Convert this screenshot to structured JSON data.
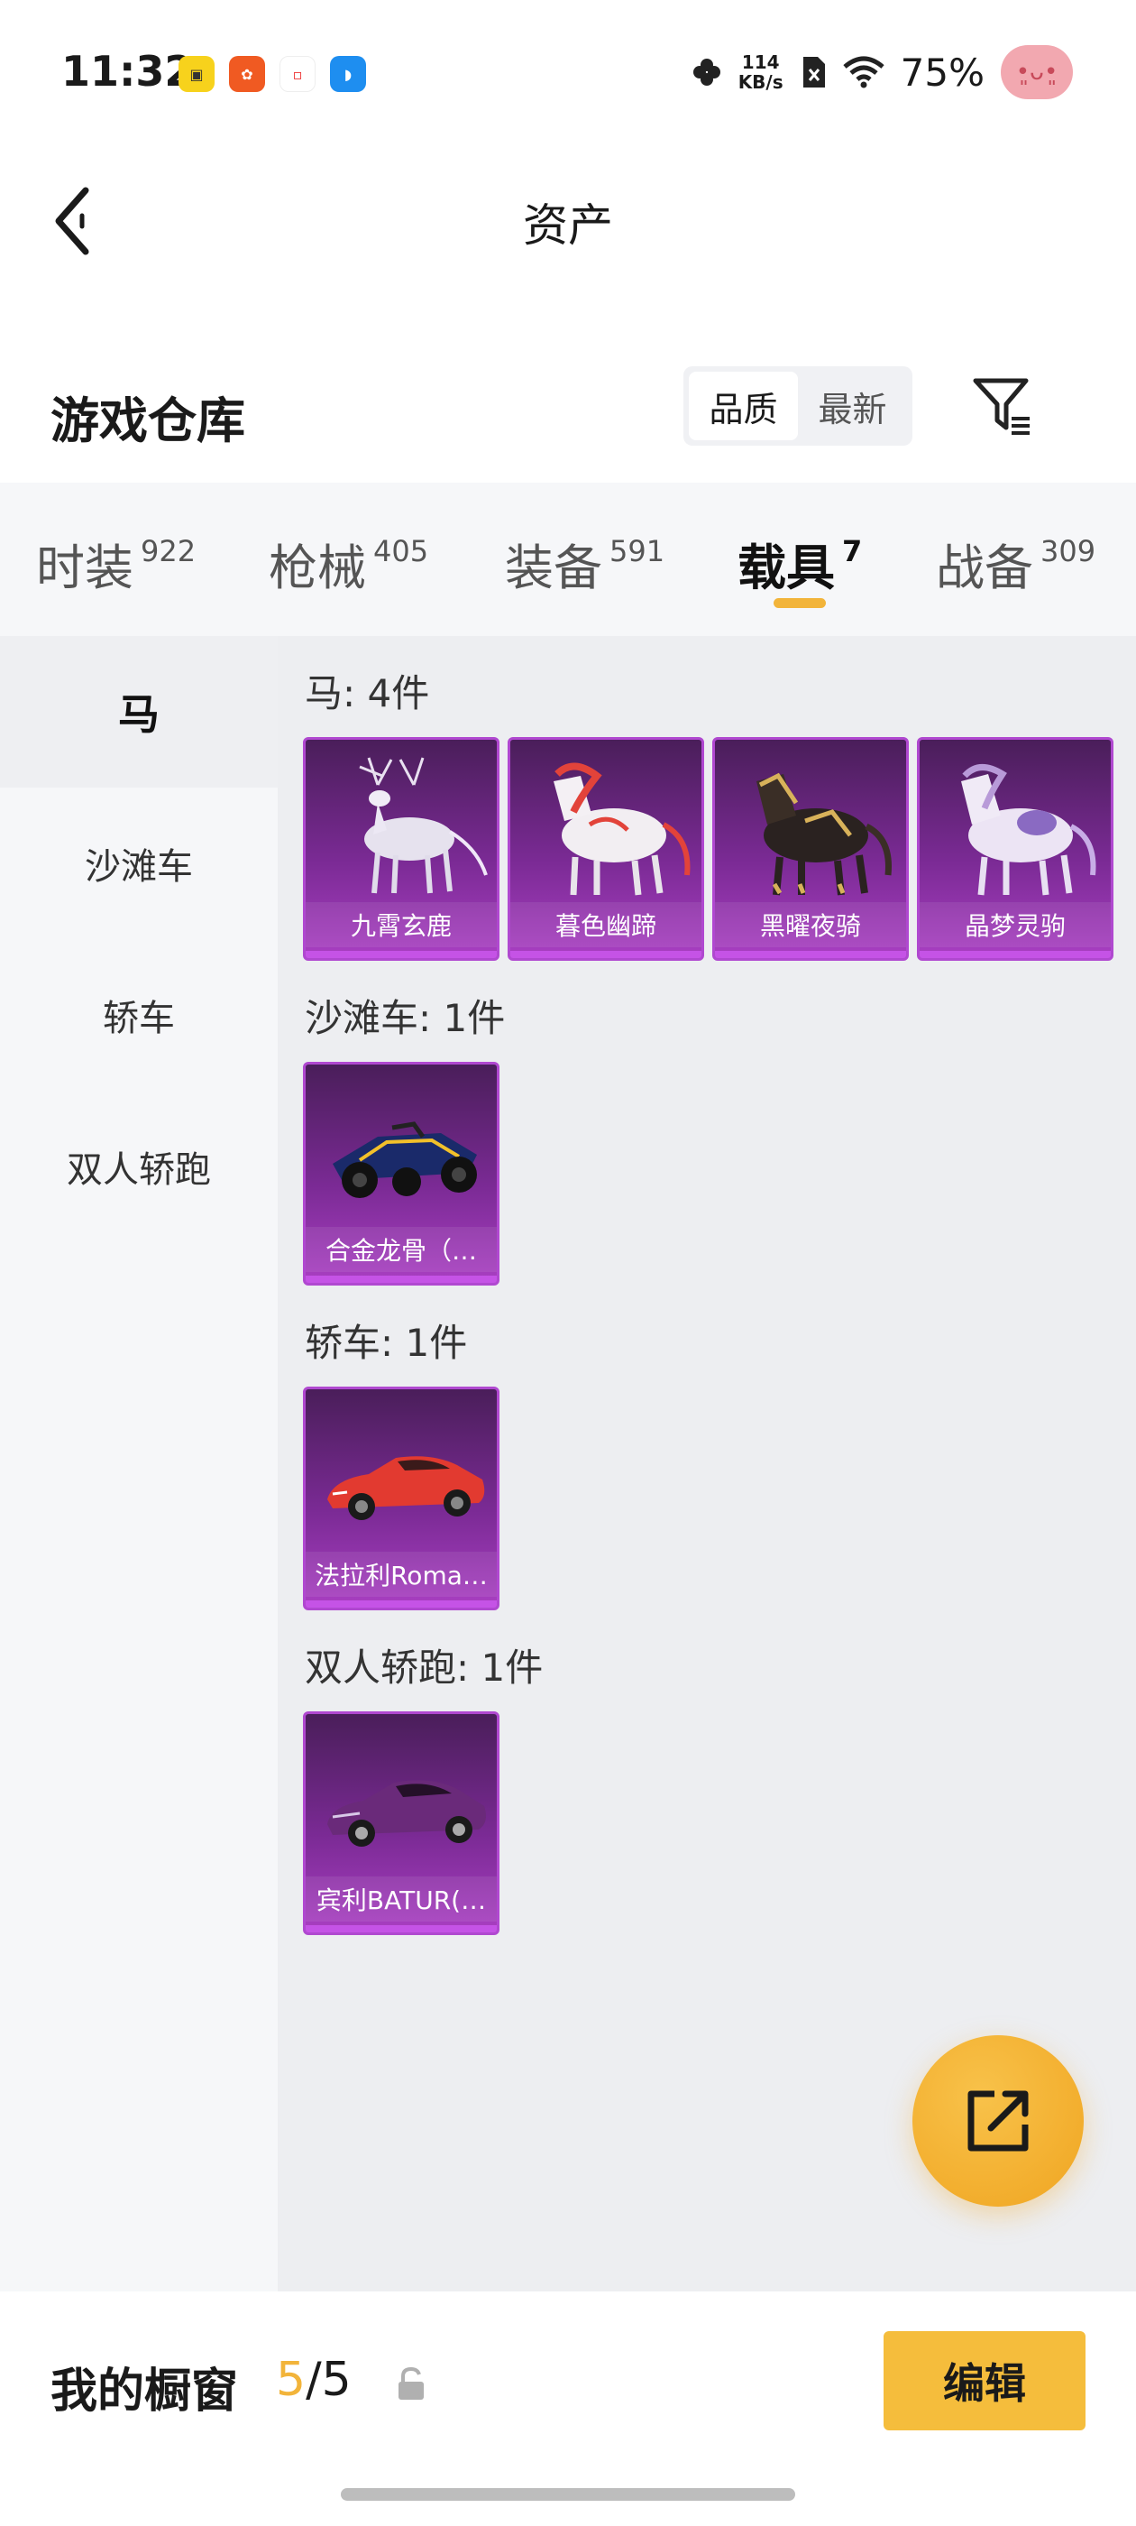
{
  "status_bar": {
    "time": "11:32",
    "net_speed_value": "114",
    "net_speed_unit": "KB/s",
    "battery": "75%"
  },
  "header": {
    "title": "资产"
  },
  "warehouse": {
    "title": "游戏仓库",
    "sort_options": [
      "品质",
      "最新"
    ],
    "active_sort": "品质"
  },
  "tabs": [
    {
      "label": "时装",
      "count": "922"
    },
    {
      "label": "枪械",
      "count": "405"
    },
    {
      "label": "装备",
      "count": "591"
    },
    {
      "label": "载具",
      "count": "7",
      "active": true
    },
    {
      "label": "战备",
      "count": "309"
    }
  ],
  "sidebar": {
    "items": [
      "马",
      "沙滩车",
      "轿车",
      "双人轿跑"
    ],
    "active": "马"
  },
  "sections": [
    {
      "title": "马: 4件",
      "items": [
        "九霄玄鹿",
        "暮色幽蹄",
        "黑曜夜骑",
        "晶梦灵驹"
      ]
    },
    {
      "title": "沙滩车: 1件",
      "items": [
        "合金龙骨（…"
      ]
    },
    {
      "title": "轿车: 1件",
      "items": [
        "法拉利Roma…"
      ]
    },
    {
      "title": "双人轿跑: 1件",
      "items": [
        "宾利BATUR(…"
      ]
    }
  ],
  "bottom_bar": {
    "label": "我的橱窗",
    "current": "5",
    "separator_total": "/5",
    "edit_label": "编辑"
  },
  "colors": {
    "accent": "#f2b43a",
    "card_purple": "#7a2a94"
  }
}
